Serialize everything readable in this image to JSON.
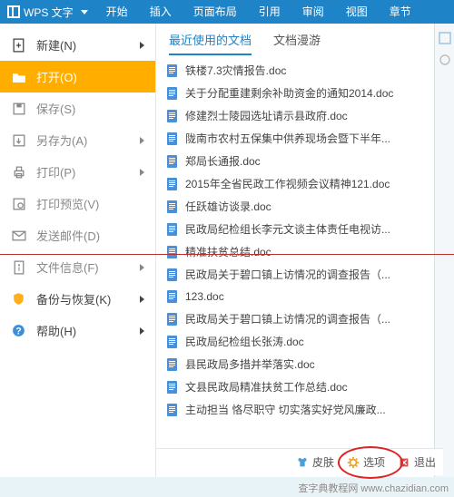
{
  "ribbon": {
    "app": "WPS 文字",
    "tabs": [
      "开始",
      "插入",
      "页面布局",
      "引用",
      "审阅",
      "视图",
      "章节"
    ]
  },
  "menu": [
    {
      "id": "new",
      "label": "新建(N)",
      "icon": "file-plus",
      "dark": true,
      "arrow": true
    },
    {
      "id": "open",
      "label": "打开(O)",
      "icon": "folder-open",
      "sel": true
    },
    {
      "id": "save",
      "label": "保存(S)",
      "icon": "floppy"
    },
    {
      "id": "saveas",
      "label": "另存为(A)",
      "icon": "floppy-arrow",
      "arrow": true
    },
    {
      "id": "print",
      "label": "打印(P)",
      "icon": "printer",
      "arrow": true
    },
    {
      "id": "preview",
      "label": "打印预览(V)",
      "icon": "print-preview"
    },
    {
      "id": "send",
      "label": "发送邮件(D)",
      "icon": "mail"
    },
    {
      "id": "info",
      "label": "文件信息(F)",
      "icon": "file-info",
      "arrow": true
    },
    {
      "id": "backup",
      "label": "备份与恢复(K)",
      "icon": "shield",
      "dark": true,
      "arrow": true
    },
    {
      "id": "help",
      "label": "帮助(H)",
      "icon": "help",
      "dark": true,
      "arrow": true
    }
  ],
  "ctabs": {
    "recent": "最近使用的文档",
    "roam": "文档漫游"
  },
  "files": [
    "铁楼7.3灾情报告.doc",
    "关于分配重建剩余补助资金的通知2014.doc",
    "修建烈士陵园选址请示县政府.doc",
    "陇南市农村五保集中供养现场会暨下半年...",
    "郑局长通报.doc",
    "2015年全省民政工作视频会议精神121.doc",
    "任跃雄访谈录.doc",
    "民政局纪检组长李元文谈主体责任电视访...",
    "精准扶贫总结.doc",
    "民政局关于碧口镇上访情况的调查报告（...",
    "123.doc",
    "民政局关于碧口镇上访情况的调查报告（...",
    "民政局纪检组长张涛.doc",
    "县民政局多措并举落实.doc",
    "文县民政局精准扶贫工作总结.doc",
    "主动担当 恪尽职守 切实落实好党风廉政..."
  ],
  "footer": {
    "skin": "皮肤",
    "options": "选项",
    "exit": "退出"
  },
  "watermark": "查字典教程网  www.chazidian.com"
}
